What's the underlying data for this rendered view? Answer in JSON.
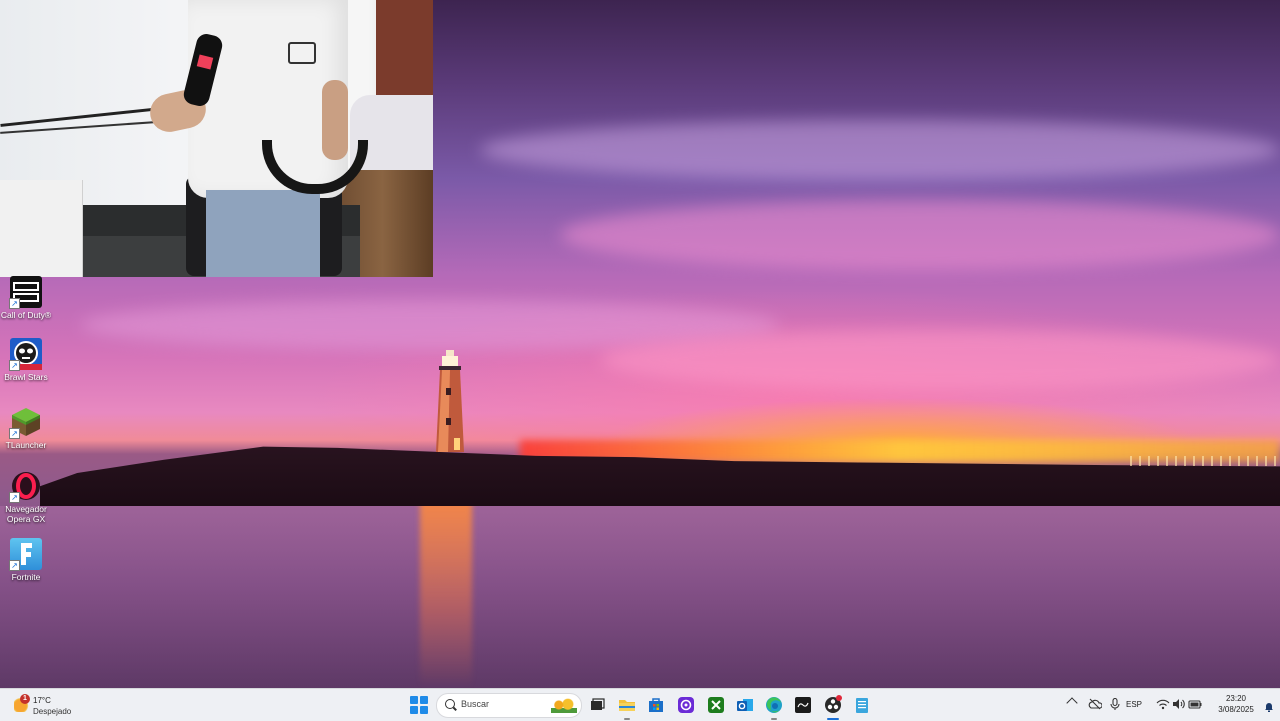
{
  "desktop": {
    "icons": [
      {
        "name": "call-of-duty",
        "label": "Call of Duty®",
        "icon": "call-of-duty-icon"
      },
      {
        "name": "brawl-stars",
        "label": "Brawl Stars",
        "icon": "brawl-stars-icon"
      },
      {
        "name": "tlauncher",
        "label": "TLauncher",
        "icon": "minecraft-block-icon"
      },
      {
        "name": "opera-gx",
        "label": "Navegador Opera GX",
        "icon": "opera-gx-icon"
      },
      {
        "name": "fortnite",
        "label": "Fortnite",
        "icon": "fortnite-icon"
      }
    ]
  },
  "taskbar": {
    "weather": {
      "temperature": "17°C",
      "condition": "Despejado",
      "badge": "1"
    },
    "search": {
      "placeholder": "Buscar"
    },
    "apps": [
      {
        "name": "task-view",
        "icon": "task-view-icon"
      },
      {
        "name": "file-explorer",
        "icon": "folder-icon"
      },
      {
        "name": "microsoft-store",
        "icon": "store-icon"
      },
      {
        "name": "app-purple",
        "icon": "purple-app-icon"
      },
      {
        "name": "xbox",
        "icon": "xbox-icon"
      },
      {
        "name": "outlook",
        "icon": "outlook-icon"
      },
      {
        "name": "edge",
        "icon": "edge-icon"
      },
      {
        "name": "steam-like",
        "icon": "app-dark-icon"
      },
      {
        "name": "obs",
        "icon": "obs-icon"
      },
      {
        "name": "notepad",
        "icon": "notepad-icon"
      }
    ],
    "tray": {
      "language": "ESP",
      "time": "23:20",
      "date": "3/08/2025"
    }
  },
  "colors": {
    "taskbar_bg": "#eef0f4",
    "accent": "#1a6fd6"
  }
}
